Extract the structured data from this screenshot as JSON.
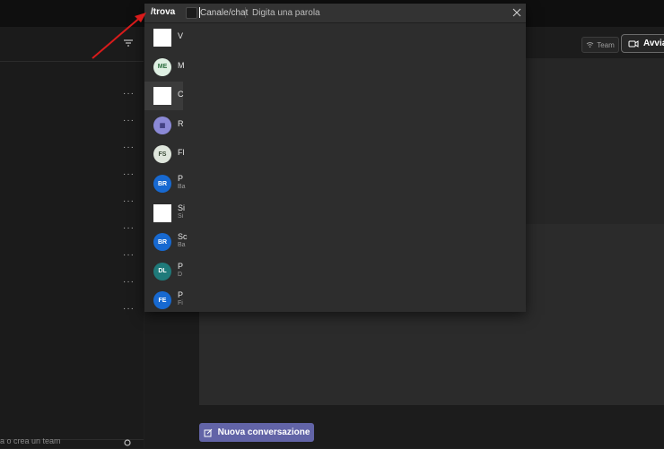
{
  "search": {
    "command": "/trova",
    "chip_label": "Canale/chat",
    "placeholder": "Digita una parola"
  },
  "header": {
    "team_label": "Team",
    "call_label": "Avvia r"
  },
  "results": [
    {
      "line1": "V",
      "line2": "",
      "avatar": "square",
      "initials": ""
    },
    {
      "line1": "M",
      "line2": "",
      "avatar": "circle",
      "initials": "ME",
      "color": "#dff0e3",
      "text_color": "#2c6e3f"
    },
    {
      "line1": "C",
      "line2": "",
      "avatar": "square",
      "initials": ""
    },
    {
      "line1": "R",
      "line2": "",
      "avatar": "circle",
      "initials": "▦",
      "color": "#8b89d6",
      "text_color": "#3b3a7a"
    },
    {
      "line1": "Fl",
      "line2": "",
      "avatar": "circle",
      "initials": "FS",
      "color": "#dfe6dc",
      "text_color": "#3a4a36"
    },
    {
      "line1": "P",
      "line2": "Ba",
      "avatar": "circle",
      "initials": "BR",
      "color": "#1769d1"
    },
    {
      "line1": "Si",
      "line2": "Si",
      "avatar": "square",
      "initials": ""
    },
    {
      "line1": "Sc",
      "line2": "Ba",
      "avatar": "circle",
      "initials": "BR",
      "color": "#1769d1"
    },
    {
      "line1": "P",
      "line2": "D",
      "avatar": "circle",
      "initials": "DL",
      "color": "#1f7a7a"
    },
    {
      "line1": "P",
      "line2": "Fi",
      "avatar": "circle",
      "initials": "FE",
      "color": "#1769d1"
    }
  ],
  "sidebar": {
    "more_label": "···",
    "bottom_hint": "a o crea un team"
  },
  "footer": {
    "new_conversation_label": "Nuova conversazione"
  }
}
